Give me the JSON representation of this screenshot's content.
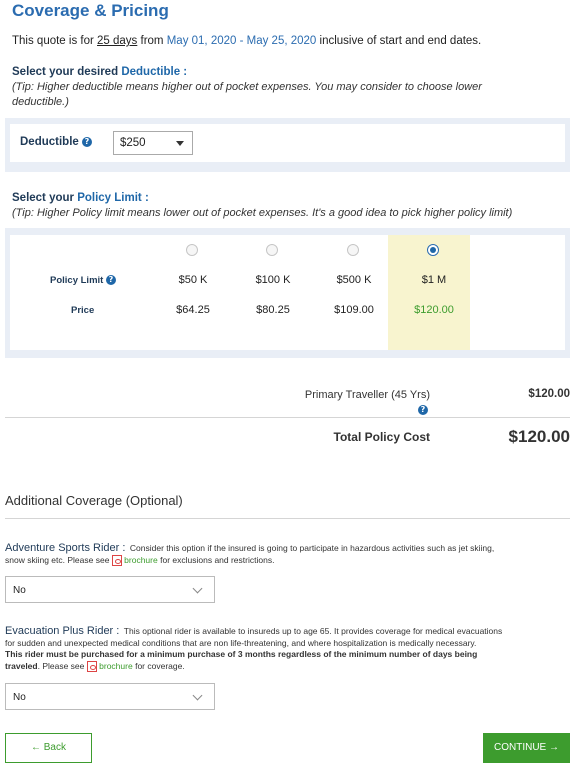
{
  "header": {
    "title": "Coverage & Pricing"
  },
  "quote": {
    "prefix": "This quote is for",
    "days": "25 days",
    "from": "from",
    "dates": "May 01, 2020 - May 25, 2020",
    "suffix": "inclusive of start and end dates."
  },
  "deductible_section": {
    "title_prefix": "Select your desired",
    "title_highlight": "Deductible :",
    "tip_line1": "(Tip: Higher deductible means higher out of pocket expenses. You may consider to choose lower",
    "tip_line2": "deductible.)",
    "label": "Deductible",
    "help": "?",
    "selected": "$250"
  },
  "policy_section": {
    "title_prefix": "Select your",
    "title_highlight": "Policy Limit :",
    "tip": "(Tip: Higher Policy limit means lower out of pocket expenses. It's a good idea to pick higher policy limit)",
    "row_label_limit": "Policy Limit",
    "row_label_price": "Price",
    "help": "?",
    "options": [
      {
        "limit": "$50 K",
        "price": "$64.25",
        "selected": false
      },
      {
        "limit": "$100 K",
        "price": "$80.25",
        "selected": false
      },
      {
        "limit": "$500 K",
        "price": "$109.00",
        "selected": false
      },
      {
        "limit": "$1 M",
        "price": "$120.00",
        "selected": true
      }
    ]
  },
  "summary": {
    "traveller_label": "Primary Traveller (45 Yrs)",
    "traveller_amount": "$120.00",
    "help": "?",
    "total_label": "Total Policy Cost",
    "total_amount": "$120.00"
  },
  "additional": {
    "title": "Additional Coverage (Optional)",
    "adventure": {
      "title": "Adventure Sports Rider :",
      "text1": "Consider this option if the insured is going to participate in hazardous activities such as jet skiing,",
      "text2_prefix": "snow skiing etc. Please see",
      "link": "brochure",
      "text2_suffix": "for exclusions and restrictions.",
      "value": "No"
    },
    "evacuation": {
      "title": "Evacuation Plus Rider :",
      "text1": "This optional rider is available to insureds up to age 65. It provides coverage for medical evacuations",
      "text2": "for sudden and unexpected medical conditions that are non life-threatening, and where hospitalization is medically necessary.",
      "bold1": "This rider must be purchased for a minimum purchase of 3 months regardless of the minimum number of days being",
      "bold2": "traveled",
      "text3_prefix": ". Please see",
      "link": "brochure",
      "text3_suffix": "for coverage.",
      "value": "No"
    }
  },
  "buttons": {
    "back": "← Back",
    "continue": "CONTINUE →"
  },
  "colors": {
    "accent": "#2b6cb0",
    "green": "#3d9c2e",
    "panel": "#e9eef6",
    "selected_column": "#f8f4cf"
  }
}
